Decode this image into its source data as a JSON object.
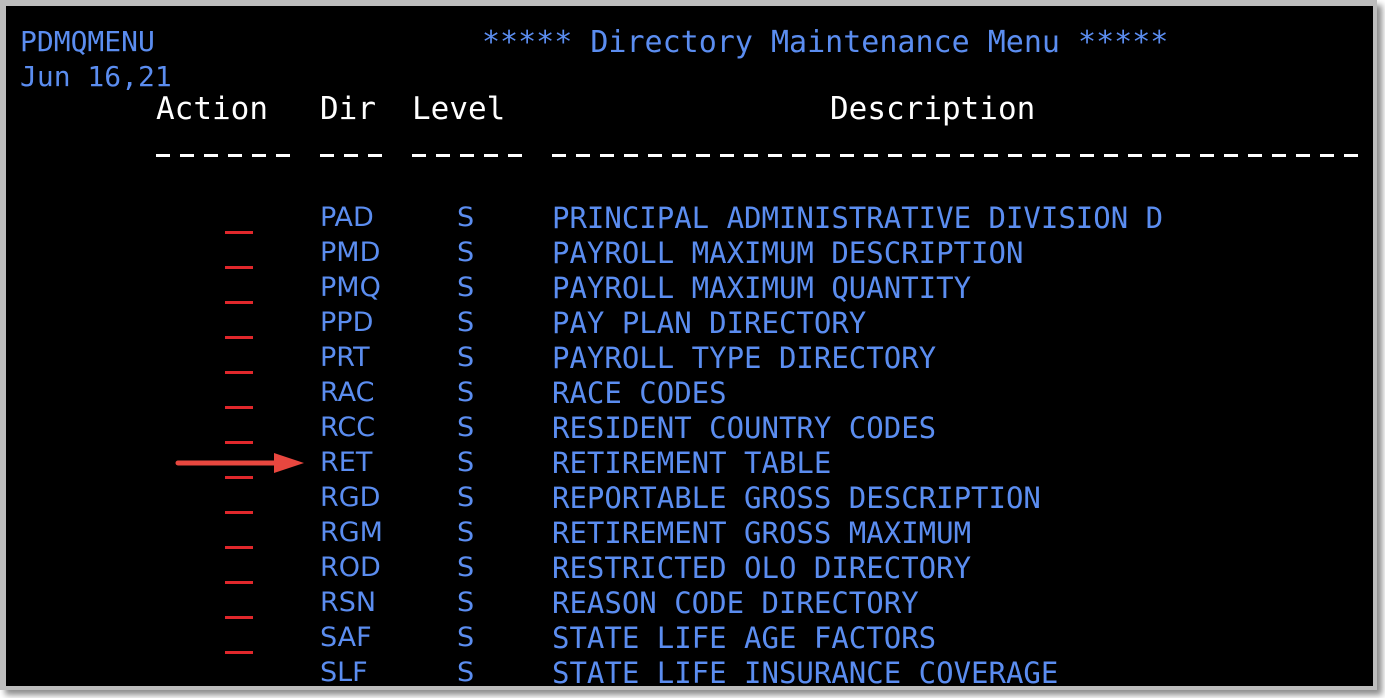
{
  "screen": {
    "program_id": "PDMQMENU",
    "date": "Jun 16,21",
    "title": "***** Directory Maintenance Menu *****"
  },
  "headers": {
    "action": "Action",
    "dir": "Dir",
    "level": "Level",
    "description": "Description"
  },
  "rows": [
    {
      "dir": "PAD",
      "level": "S",
      "description": "PRINCIPAL ADMINISTRATIVE DIVISION D"
    },
    {
      "dir": "PMD",
      "level": "S",
      "description": "PAYROLL MAXIMUM DESCRIPTION"
    },
    {
      "dir": "PMQ",
      "level": "S",
      "description": "PAYROLL MAXIMUM QUANTITY"
    },
    {
      "dir": "PPD",
      "level": "S",
      "description": "PAY PLAN DIRECTORY"
    },
    {
      "dir": "PRT",
      "level": "S",
      "description": "PAYROLL TYPE DIRECTORY"
    },
    {
      "dir": "RAC",
      "level": "S",
      "description": "RACE CODES"
    },
    {
      "dir": "RCC",
      "level": "S",
      "description": "RESIDENT COUNTRY CODES"
    },
    {
      "dir": "RET",
      "level": "S",
      "description": "RETIREMENT TABLE"
    },
    {
      "dir": "RGD",
      "level": "S",
      "description": "REPORTABLE GROSS DESCRIPTION"
    },
    {
      "dir": "RGM",
      "level": "S",
      "description": "RETIREMENT GROSS MAXIMUM"
    },
    {
      "dir": "ROD",
      "level": "S",
      "description": "RESTRICTED OLO DIRECTORY"
    },
    {
      "dir": "RSN",
      "level": "S",
      "description": "REASON CODE DIRECTORY"
    },
    {
      "dir": "SAF",
      "level": "S",
      "description": "STATE LIFE AGE FACTORS"
    },
    {
      "dir": "SLF",
      "level": "S",
      "description": "STATE LIFE INSURANCE COVERAGE"
    }
  ],
  "annotation": {
    "type": "pointer-arrow-icon",
    "points_to_dir": "RET"
  },
  "colors": {
    "background": "#000000",
    "text_blue": "#5b8df0",
    "header_white": "#ffffff",
    "action_field_red": "#e0272b",
    "arrow": "#e8473f"
  }
}
